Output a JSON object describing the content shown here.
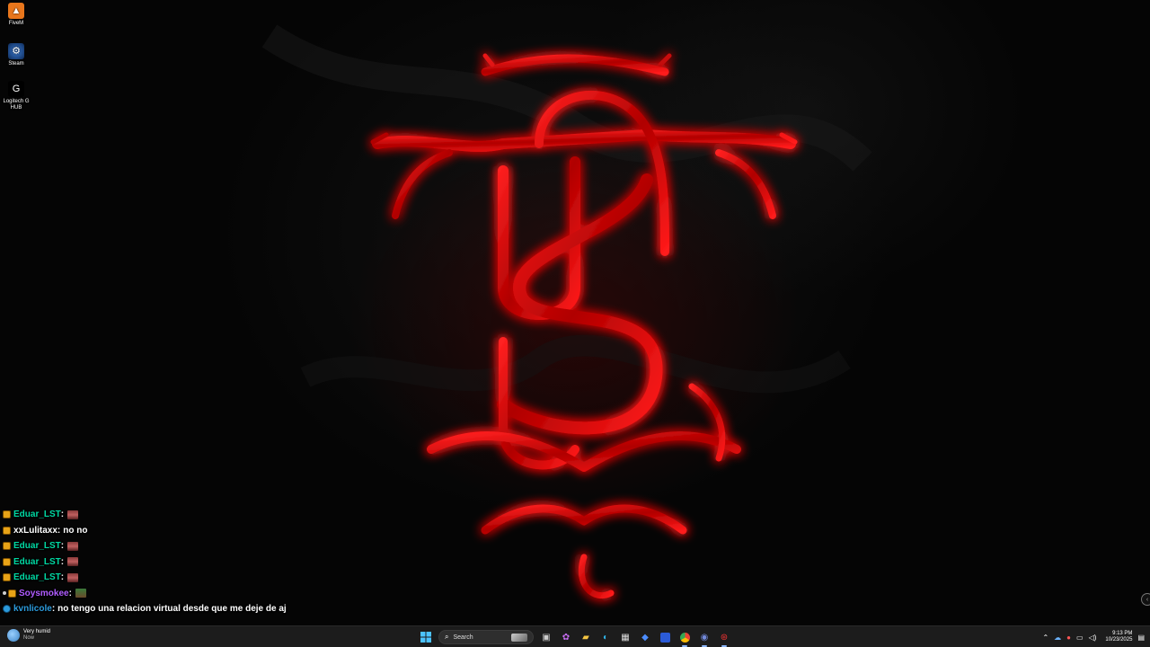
{
  "desktop_icons": [
    {
      "label": "FiveM",
      "icon": "fivem-icon"
    },
    {
      "label": "Steam",
      "icon": "steam-icon"
    },
    {
      "label": "Logitech G HUB",
      "icon": "logitech-icon"
    }
  ],
  "chat": [
    {
      "user": "Eduar_LST",
      "sep": " :",
      "message": "",
      "badge": "gold",
      "emote": "red",
      "color": "#00d9a3"
    },
    {
      "user": "xxLulitaxx",
      "sep": " :",
      "message": "no no",
      "badge": "gold",
      "emote": "",
      "color": "#ffffff"
    },
    {
      "user": "Eduar_LST",
      "sep": " :",
      "message": "",
      "badge": "gold",
      "emote": "red",
      "color": "#00d9a3"
    },
    {
      "user": "Eduar_LST",
      "sep": " :",
      "message": "",
      "badge": "gold",
      "emote": "red",
      "color": "#00d9a3"
    },
    {
      "user": "Eduar_LST",
      "sep": " :",
      "message": "",
      "badge": "gold",
      "emote": "red",
      "color": "#00d9a3"
    },
    {
      "user": "Soysmokee",
      "sep": " :",
      "message": "",
      "badge": "gold-dot",
      "emote": "green",
      "color": "#b05cff"
    },
    {
      "user": "kvnlicole",
      "sep": " :",
      "message": "no tengo una relacion virtual desde que me deje de aj",
      "badge": "blue",
      "emote": "",
      "color": "#2c9bdc"
    }
  ],
  "taskbar": {
    "weather_title": "Very humid",
    "weather_sub": "Now",
    "search_placeholder": "Search",
    "time": "9:13 PM",
    "date": "10/23/2025"
  },
  "colors": {
    "accent_red": "#d00000",
    "taskbar_bg": "#1c1c1c"
  }
}
